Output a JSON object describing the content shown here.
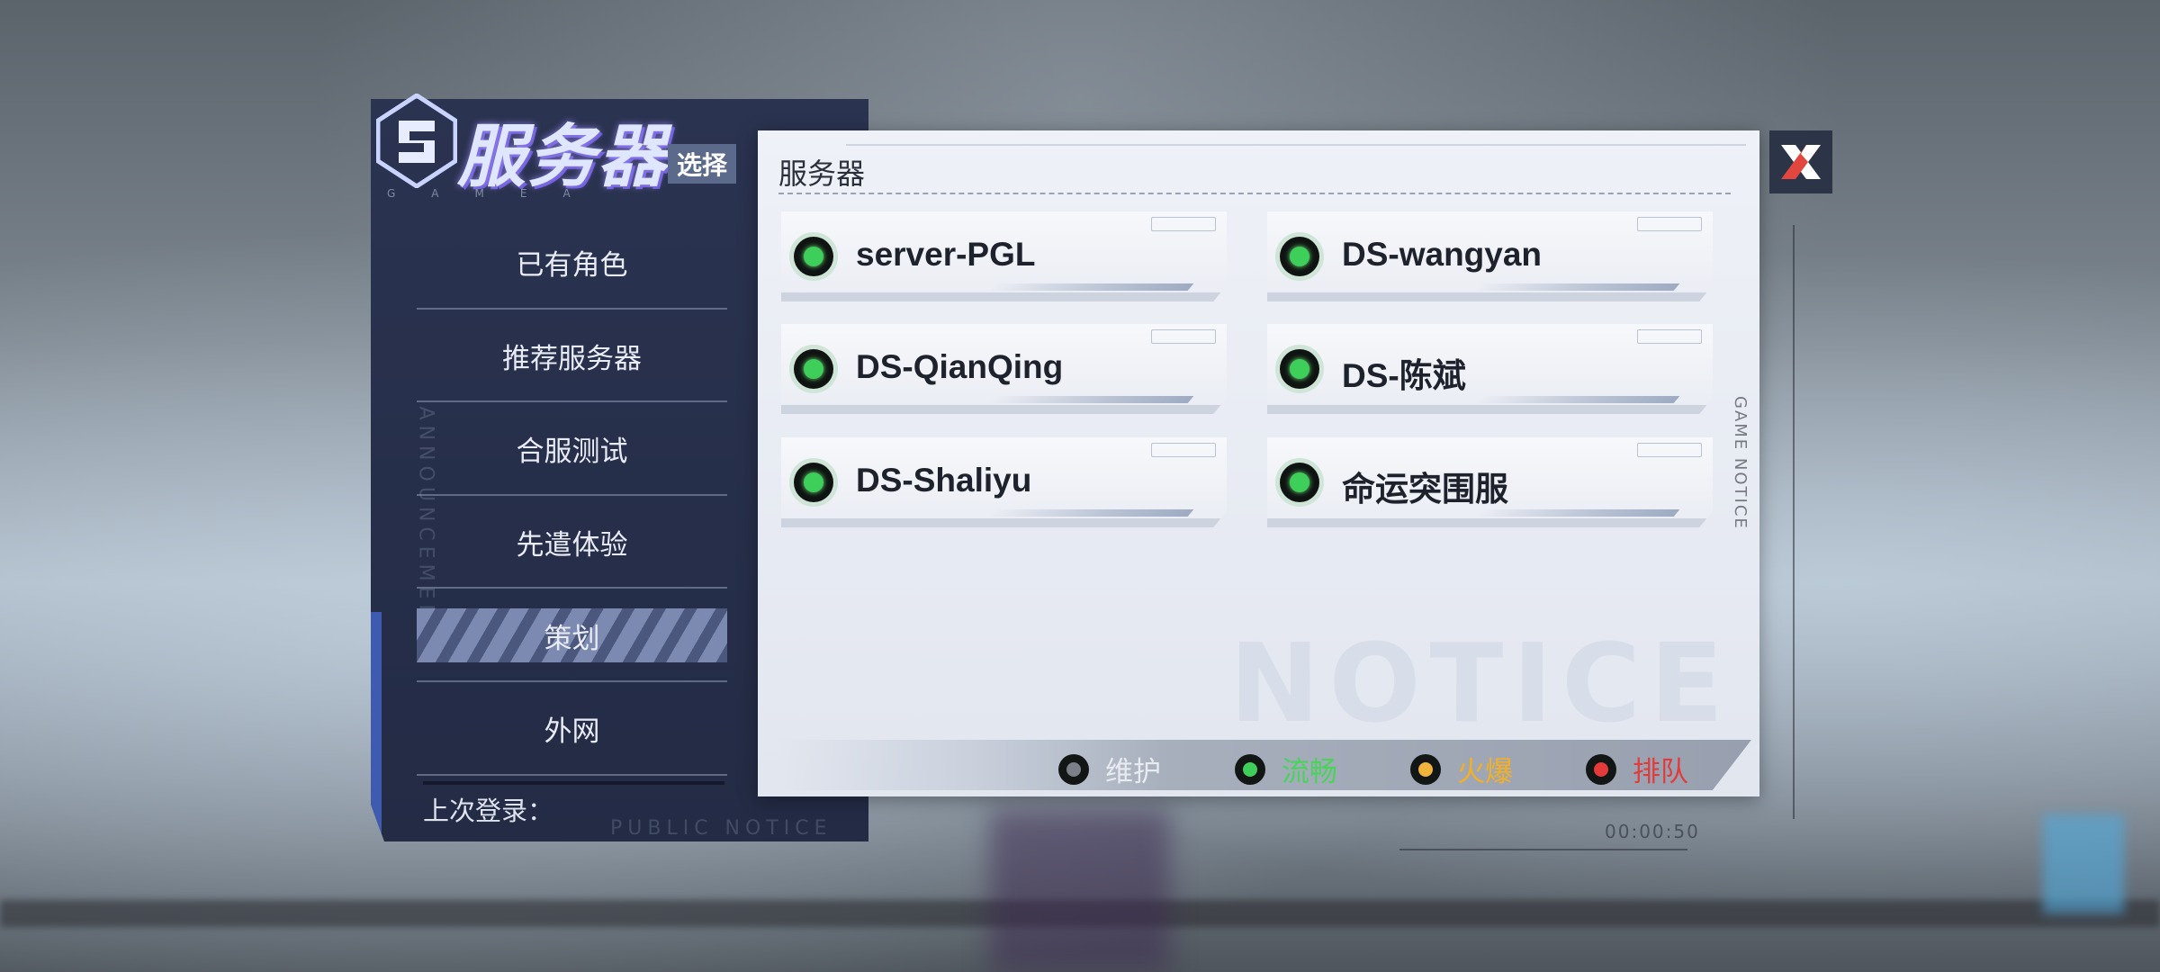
{
  "header": {
    "title": "服务器",
    "badge": "选择",
    "subtitle": "GAMEA"
  },
  "sidebar": {
    "items": [
      {
        "label": "已有角色",
        "active": false
      },
      {
        "label": "推荐服务器",
        "active": false
      },
      {
        "label": "合服测试",
        "active": false
      },
      {
        "label": "先遣体验",
        "active": false
      },
      {
        "label": "策划",
        "active": true
      },
      {
        "label": "外网",
        "active": false
      }
    ],
    "last_login": "上次登录："
  },
  "decor": {
    "announcement": "ANNOUNCEMENT",
    "public_notice": "PUBLIC NOTICE",
    "game_notice": "GAME NOTICE",
    "watermark": "NOTICE",
    "timer": "00:00:50"
  },
  "main": {
    "title": "服务器",
    "servers": [
      {
        "name": "server-PGL",
        "status": "流畅"
      },
      {
        "name": "DS-wangyan",
        "status": "流畅"
      },
      {
        "name": "DS-QianQing",
        "status": "流畅"
      },
      {
        "name": "DS-陈斌",
        "status": "流畅"
      },
      {
        "name": "DS-Shaliyu",
        "status": "流畅"
      },
      {
        "name": "命运突围服",
        "status": "流畅"
      }
    ]
  },
  "legend": [
    {
      "label": "维护",
      "color": "#7a7f88",
      "text_color": "#e8ebf0"
    },
    {
      "label": "流畅",
      "color": "#3ecf5a",
      "text_color": "#49d35b"
    },
    {
      "label": "火爆",
      "color": "#f0b43a",
      "text_color": "#f5b021"
    },
    {
      "label": "排队",
      "color": "#e43a3a",
      "text_color": "#e23b3b"
    }
  ],
  "close": {
    "icon": "close-icon"
  }
}
